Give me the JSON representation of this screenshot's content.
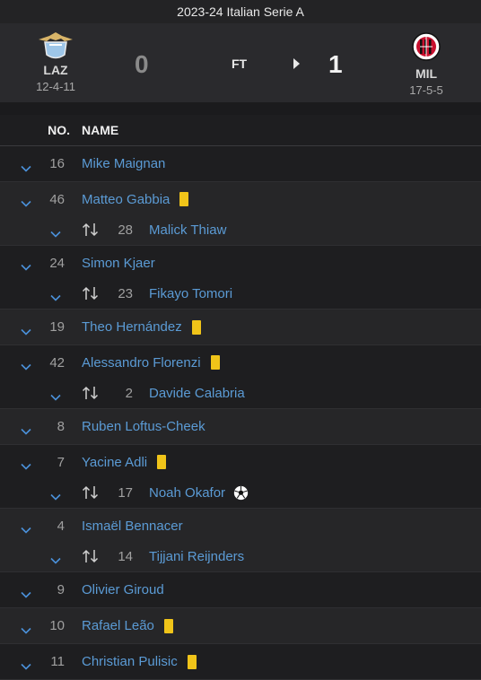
{
  "header": {
    "title": "2023-24 Italian Serie A"
  },
  "match": {
    "home": {
      "abbr": "LAZ",
      "record": "12-4-11",
      "score": "0",
      "logo": "lazio-eagle-crest"
    },
    "away": {
      "abbr": "MIL",
      "record": "17-5-5",
      "score": "1",
      "logo": "ac-milan-crest"
    },
    "status": "FT"
  },
  "columns": {
    "no": "NO.",
    "name": "NAME"
  },
  "players": [
    {
      "no": "16",
      "name": "Mike Maignan",
      "yellow": false
    },
    {
      "no": "46",
      "name": "Matteo Gabbia",
      "yellow": true,
      "sub": {
        "no": "28",
        "name": "Malick Thiaw"
      }
    },
    {
      "no": "24",
      "name": "Simon Kjaer",
      "yellow": false,
      "sub": {
        "no": "23",
        "name": "Fikayo Tomori"
      }
    },
    {
      "no": "19",
      "name": "Theo Hernández",
      "yellow": true
    },
    {
      "no": "42",
      "name": "Alessandro Florenzi",
      "yellow": true,
      "sub": {
        "no": "2",
        "name": "Davide Calabria"
      }
    },
    {
      "no": "8",
      "name": "Ruben Loftus-Cheek",
      "yellow": false
    },
    {
      "no": "7",
      "name": "Yacine Adli",
      "yellow": true,
      "sub": {
        "no": "17",
        "name": "Noah Okafor",
        "goal": true
      }
    },
    {
      "no": "4",
      "name": "Ismaël Bennacer",
      "yellow": false,
      "sub": {
        "no": "14",
        "name": "Tijjani Reijnders"
      }
    },
    {
      "no": "9",
      "name": "Olivier Giroud",
      "yellow": false
    },
    {
      "no": "10",
      "name": "Rafael Leão",
      "yellow": true
    },
    {
      "no": "11",
      "name": "Christian Pulisic",
      "yellow": true
    }
  ],
  "colors": {
    "link": "#5b9bd5",
    "yellow_card": "#f0c419",
    "accent": "#4a90d9"
  }
}
